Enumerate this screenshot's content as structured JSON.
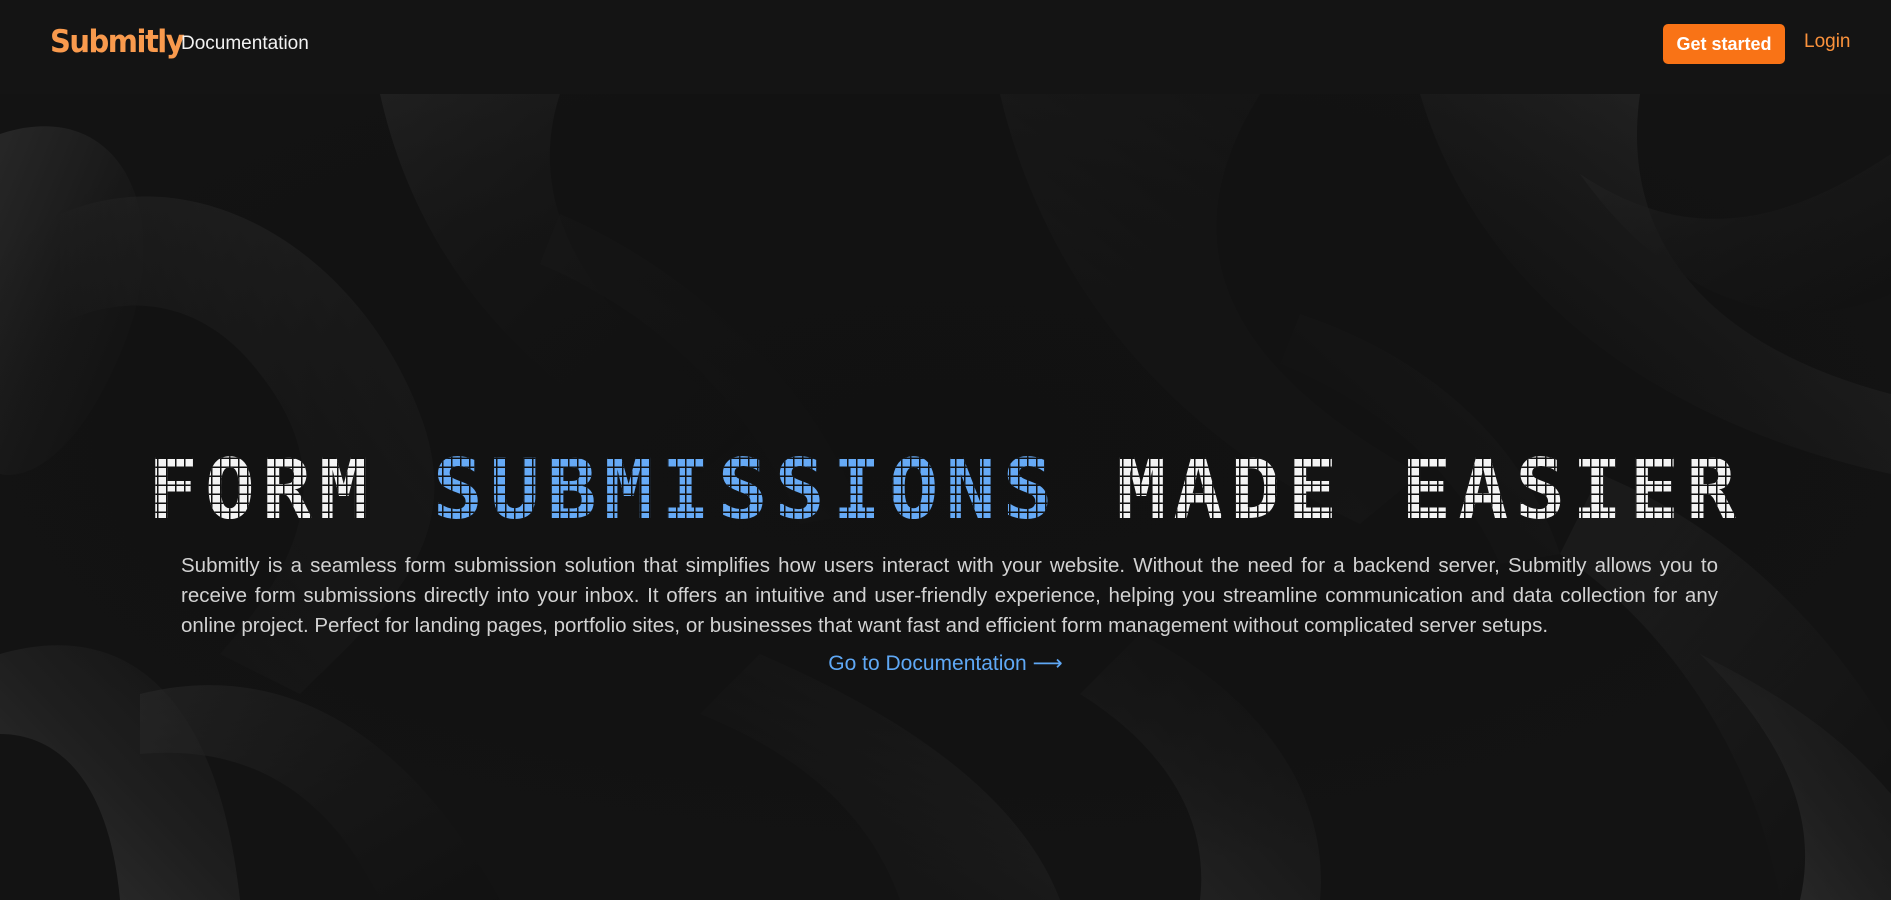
{
  "navbar": {
    "logo": "Submitly",
    "docs_link": "Documentation",
    "get_started": "Get started",
    "login": "Login"
  },
  "hero": {
    "headline_part1": "FORM ",
    "headline_highlight": "SUBMISSIONS",
    "headline_part2": " MADE EASIER",
    "description": "Submitly is a seamless form submission solution that simplifies how users interact with your website. Without the need for a backend server, Submitly allows you to receive form submissions directly into your inbox. It offers an intuitive and user-friendly experience, helping you streamline communication and data collection for any online project. Perfect for landing pages, portfolio sites, or businesses that want fast and efficient form management without complicated server setups.",
    "docs_cta": "Go to Documentation",
    "docs_cta_arrow": "⟶"
  },
  "colors": {
    "accent_orange": "#f97316",
    "logo_orange": "#f99a4d",
    "link_orange": "#fb923c",
    "highlight_blue": "#66aaf6",
    "cta_blue": "#5fa8f5",
    "background": "#121212"
  }
}
